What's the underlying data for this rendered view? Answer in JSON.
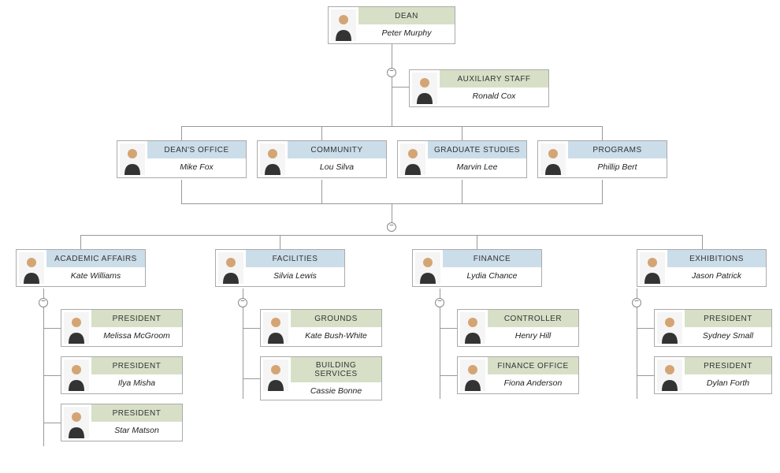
{
  "nodes": {
    "dean": {
      "title": "DEAN",
      "name": "Peter Murphy"
    },
    "aux": {
      "title": "AUXILIARY STAFF",
      "name": "Ronald Cox"
    },
    "deans_office": {
      "title": "DEAN'S OFFICE",
      "name": "Mike Fox"
    },
    "community": {
      "title": "COMMUNITY",
      "name": "Lou Silva"
    },
    "grad": {
      "title": "GRADUATE STUDIES",
      "name": "Marvin Lee"
    },
    "programs": {
      "title": "PROGRAMS",
      "name": "Phillip Bert"
    },
    "academic": {
      "title": "ACADEMIC AFFAIRS",
      "name": "Kate Williams"
    },
    "facilities": {
      "title": "FACILITIES",
      "name": "Silvia Lewis"
    },
    "finance": {
      "title": "FINANCE",
      "name": "Lydia Chance"
    },
    "exhibitions": {
      "title": "EXHIBITIONS",
      "name": "Jason Patrick"
    },
    "pres1": {
      "title": "PRESIDENT",
      "name": "Melissa McGroom"
    },
    "pres2": {
      "title": "PRESIDENT",
      "name": "Ilya Misha"
    },
    "pres3": {
      "title": "PRESIDENT",
      "name": "Star Matson"
    },
    "grounds": {
      "title": "GROUNDS",
      "name": "Kate Bush-White"
    },
    "building": {
      "title": "BUILDING SERVICES",
      "name": "Cassie Bonne"
    },
    "controller": {
      "title": "CONTROLLER",
      "name": "Henry Hill"
    },
    "finoffice": {
      "title": "FINANCE OFFICE",
      "name": "Fiona Anderson"
    },
    "pres4": {
      "title": "PRESIDENT",
      "name": "Sydney Small"
    },
    "pres5": {
      "title": "PRESIDENT",
      "name": "Dylan Forth"
    }
  },
  "chart_data": {
    "type": "tree",
    "root": {
      "title": "DEAN",
      "name": "Peter Murphy",
      "color": "green",
      "children": [
        {
          "title": "AUXILIARY STAFF",
          "name": "Ronald Cox",
          "color": "green",
          "side": true
        },
        {
          "title": "DEAN'S OFFICE",
          "name": "Mike Fox",
          "color": "blue"
        },
        {
          "title": "COMMUNITY",
          "name": "Lou Silva",
          "color": "blue"
        },
        {
          "title": "GRADUATE STUDIES",
          "name": "Marvin Lee",
          "color": "blue"
        },
        {
          "title": "PROGRAMS",
          "name": "Phillip Bert",
          "color": "blue"
        }
      ],
      "grandchildren_shared": [
        {
          "title": "ACADEMIC AFFAIRS",
          "name": "Kate Williams",
          "color": "blue",
          "children": [
            {
              "title": "PRESIDENT",
              "name": "Melissa McGroom",
              "color": "green"
            },
            {
              "title": "PRESIDENT",
              "name": "Ilya Misha",
              "color": "green"
            },
            {
              "title": "PRESIDENT",
              "name": "Star Matson",
              "color": "green"
            }
          ]
        },
        {
          "title": "FACILITIES",
          "name": "Silvia Lewis",
          "color": "blue",
          "children": [
            {
              "title": "GROUNDS",
              "name": "Kate Bush-White",
              "color": "green"
            },
            {
              "title": "BUILDING SERVICES",
              "name": "Cassie Bonne",
              "color": "green"
            }
          ]
        },
        {
          "title": "FINANCE",
          "name": "Lydia Chance",
          "color": "blue",
          "children": [
            {
              "title": "CONTROLLER",
              "name": "Henry Hill",
              "color": "green"
            },
            {
              "title": "FINANCE OFFICE",
              "name": "Fiona Anderson",
              "color": "green"
            }
          ]
        },
        {
          "title": "EXHIBITIONS",
          "name": "Jason Patrick",
          "color": "blue",
          "children": [
            {
              "title": "PRESIDENT",
              "name": "Sydney Small",
              "color": "green"
            },
            {
              "title": "PRESIDENT",
              "name": "Dylan Forth",
              "color": "green"
            }
          ]
        }
      ]
    }
  }
}
